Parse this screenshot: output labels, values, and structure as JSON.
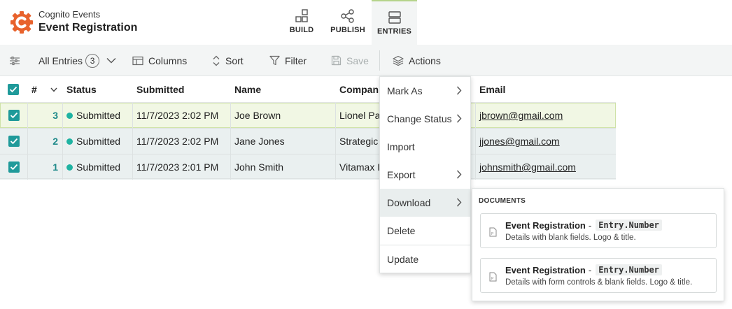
{
  "header": {
    "app_name": "Cognito Events",
    "form_name": "Event Registration",
    "tabs": [
      {
        "label": "BUILD",
        "icon": "grid-icon"
      },
      {
        "label": "PUBLISH",
        "icon": "share-icon"
      },
      {
        "label": "ENTRIES",
        "icon": "entries-icon",
        "active": true
      }
    ],
    "brand_color": "#e8622c",
    "active_tab_accent": "#b5d48b"
  },
  "toolbar": {
    "view_label": "All Entries",
    "view_count": "3",
    "columns_label": "Columns",
    "sort_label": "Sort",
    "filter_label": "Filter",
    "save_label": "Save",
    "actions_label": "Actions"
  },
  "table": {
    "headers": {
      "number": "#",
      "status": "Status",
      "submitted": "Submitted",
      "name": "Name",
      "company": "Compan",
      "email": "Email"
    },
    "rows": [
      {
        "number": "3",
        "status": "Submitted",
        "submitted": "11/7/2023 2:02 PM",
        "name": "Joe Brown",
        "company": "Lionel Pa",
        "email": "jbrown@gmail.com",
        "checked": true
      },
      {
        "number": "2",
        "status": "Submitted",
        "submitted": "11/7/2023 2:02 PM",
        "name": "Jane Jones",
        "company": "Strategic",
        "email": "jjones@gmail.com",
        "checked": true
      },
      {
        "number": "1",
        "status": "Submitted",
        "submitted": "11/7/2023 2:01 PM",
        "name": "John Smith",
        "company": "Vitamax I",
        "email": "johnsmith@gmail.com",
        "checked": true
      }
    ],
    "status_color": "#1fb3a2",
    "checkbox_color": "#1f9a9a"
  },
  "actions_menu": {
    "items": [
      {
        "label": "Mark As",
        "has_submenu": true
      },
      {
        "label": "Change Status",
        "has_submenu": true
      },
      {
        "label": "Import",
        "has_submenu": false
      },
      {
        "label": "Export",
        "has_submenu": true
      },
      {
        "label": "Download",
        "has_submenu": true,
        "active": true
      },
      {
        "label": "Delete",
        "has_submenu": false
      },
      {
        "label": "Update",
        "has_submenu": false
      }
    ]
  },
  "documents_menu": {
    "heading": "DOCUMENTS",
    "documents": [
      {
        "title": "Event Registration",
        "dash": "-",
        "token": "Entry.Number",
        "description": "Details with blank fields. Logo & title."
      },
      {
        "title": "Event Registration",
        "dash": "-",
        "token": "Entry.Number",
        "description": "Details with form controls & blank fields. Logo & title."
      }
    ]
  }
}
